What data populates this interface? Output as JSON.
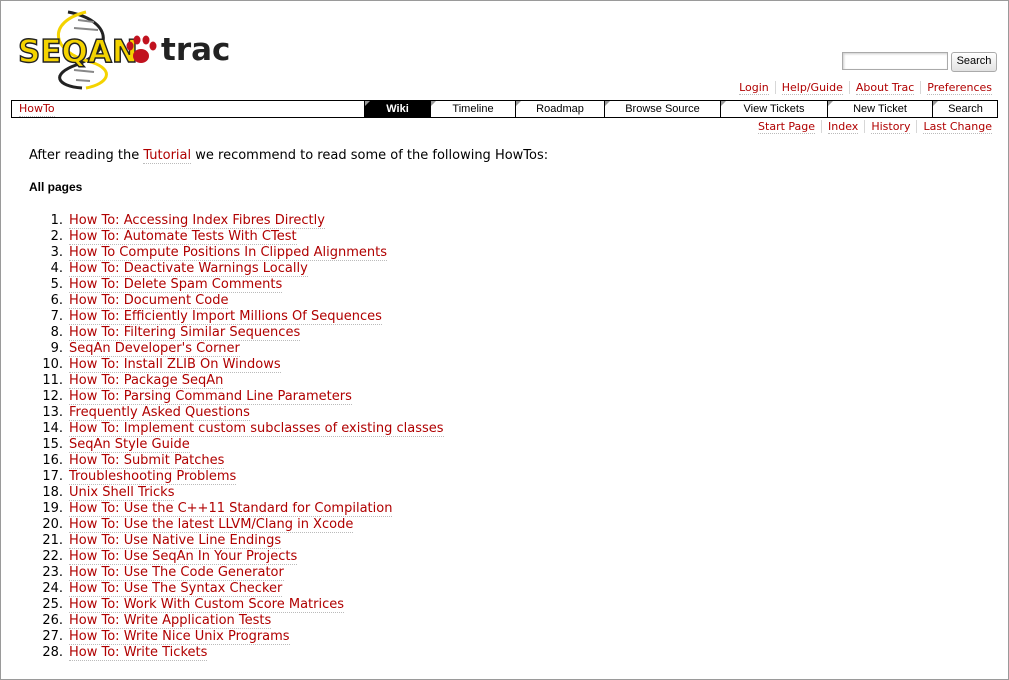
{
  "logo": {
    "brand_text": "SEQAN",
    "product_text": "trac"
  },
  "search": {
    "value": "",
    "button_label": "Search"
  },
  "metanav": [
    {
      "label": "Login"
    },
    {
      "label": "Help/Guide"
    },
    {
      "label": "About Trac"
    },
    {
      "label": "Preferences"
    }
  ],
  "breadcrumb": {
    "label": "HowTo"
  },
  "mainnav": [
    {
      "label": "Wiki",
      "active": true
    },
    {
      "label": "Timeline"
    },
    {
      "label": "Roadmap"
    },
    {
      "label": "Browse Source"
    },
    {
      "label": "View Tickets"
    },
    {
      "label": "New Ticket"
    },
    {
      "label": "Search"
    }
  ],
  "ctxnav": [
    {
      "label": "Start Page"
    },
    {
      "label": "Index"
    },
    {
      "label": "History"
    },
    {
      "label": "Last Change"
    }
  ],
  "content": {
    "intro_before": "After reading the ",
    "intro_link": "Tutorial",
    "intro_after": " we recommend to read some of the following HowTos:",
    "heading": "All pages",
    "pages": [
      "How To: Accessing Index Fibres Directly",
      "How To: Automate Tests With CTest",
      "How To Compute Positions In Clipped Alignments",
      "How To: Deactivate Warnings Locally",
      "How To: Delete Spam Comments",
      "How To: Document Code",
      "How To: Efficiently Import Millions Of Sequences",
      "How To: Filtering Similar Sequences",
      "SeqAn Developer's Corner",
      "How To: Install ZLIB On Windows",
      "How To: Package SeqAn",
      "How To: Parsing Command Line Parameters",
      "Frequently Asked Questions",
      "How To: Implement custom subclasses of existing classes",
      "SeqAn Style Guide",
      "How To: Submit Patches",
      "Troubleshooting Problems",
      "Unix Shell Tricks",
      "How To: Use the C++11 Standard for Compilation",
      "How To: Use the latest LLVM/Clang in Xcode",
      "How To: Use Native Line Endings",
      "How To: Use SeqAn In Your Projects",
      "How To: Use The Code Generator",
      "How To: Use The Syntax Checker",
      "How To: Work With Custom Score Matrices",
      "How To: Write Application Tests",
      "How To: Write Nice Unix Programs",
      "How To: Write Tickets"
    ]
  },
  "colors": {
    "link": "#b00000",
    "nav_active_bg": "#000000",
    "logo_yellow": "#f4d300",
    "logo_red": "#c1121f"
  }
}
